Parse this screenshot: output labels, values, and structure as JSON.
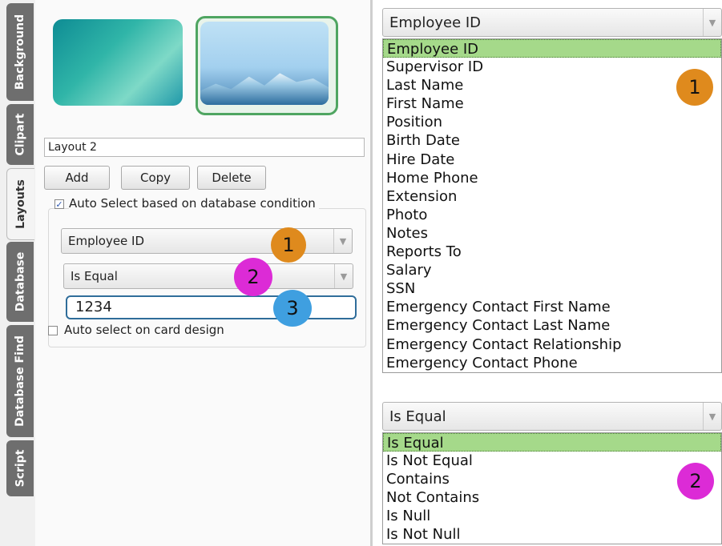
{
  "tabs": [
    "Background",
    "Clipart",
    "Layouts",
    "Database",
    "Database Find",
    "Script"
  ],
  "active_tab": "Layouts",
  "layout_name": "Layout 2",
  "buttons": {
    "add": "Add",
    "copy": "Copy",
    "delete": "Delete"
  },
  "auto_select_label": "Auto Select based on database condition",
  "auto_select_checked": true,
  "field_combo": "Employee ID",
  "operator_combo": "Is Equal",
  "value_input": "1234",
  "auto_select_card_label": "Auto select on card design",
  "auto_select_card_checked": false,
  "badges": {
    "one": "1",
    "two": "2",
    "three": "3"
  },
  "badge_colors": {
    "one": "#df8a1d",
    "two": "#dc2bd6",
    "three": "#3f9fe0"
  },
  "field_dropdown": {
    "value": "Employee ID",
    "selected": "Employee ID",
    "options": [
      "Employee ID",
      "Supervisor ID",
      "Last Name",
      "First Name",
      "Position",
      "Birth Date",
      "Hire Date",
      "Home Phone",
      "Extension",
      "Photo",
      "Notes",
      "Reports To",
      "Salary",
      "SSN",
      "Emergency Contact First Name",
      "Emergency Contact Last Name",
      "Emergency Contact Relationship",
      "Emergency Contact Phone"
    ]
  },
  "operator_dropdown": {
    "value": "Is Equal",
    "selected": "Is Equal",
    "options": [
      "Is Equal",
      "Is Not Equal",
      "Contains",
      "Not Contains",
      "Is Null",
      "Is Not Null"
    ]
  },
  "colors": {
    "selection": "#a5d98a",
    "thumb_border": "#4fa561",
    "tab_bg": "#6e6e6e"
  }
}
